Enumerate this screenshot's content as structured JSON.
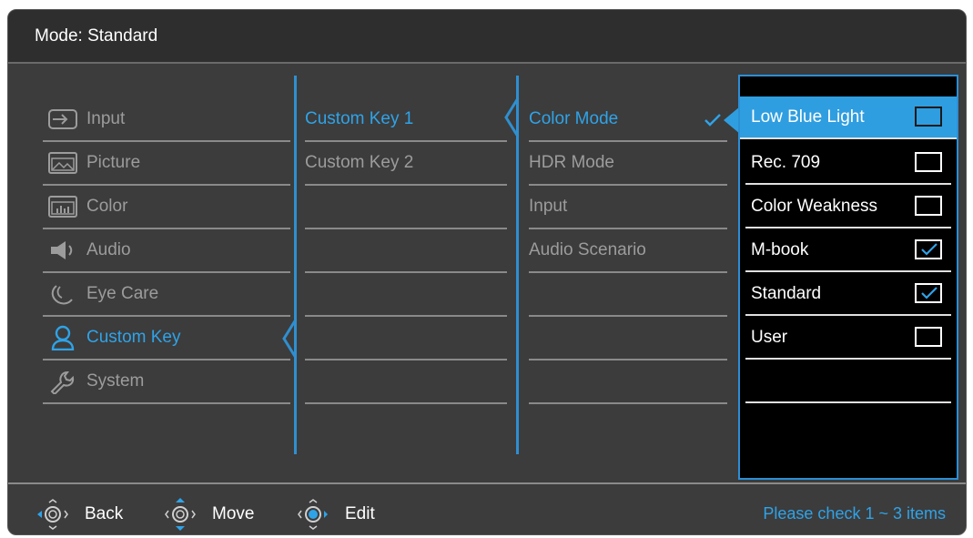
{
  "header": {
    "title": "Mode: Standard"
  },
  "menu": {
    "items": [
      {
        "label": "Input",
        "icon": "input-icon"
      },
      {
        "label": "Picture",
        "icon": "picture-icon"
      },
      {
        "label": "Color",
        "icon": "color-icon"
      },
      {
        "label": "Audio",
        "icon": "speaker-icon"
      },
      {
        "label": "Eye Care",
        "icon": "eye-care-icon"
      },
      {
        "label": "Custom Key",
        "icon": "user-icon"
      },
      {
        "label": "System",
        "icon": "wrench-icon"
      }
    ],
    "selected": "Custom Key"
  },
  "submenu": {
    "items": [
      "Custom Key 1",
      "Custom Key 2"
    ],
    "selected": "Custom Key 1"
  },
  "functions": {
    "items": [
      "Color Mode",
      "HDR Mode",
      "Input",
      "Audio Scenario"
    ],
    "selected": "Color Mode"
  },
  "options": {
    "items": [
      {
        "label": "Low Blue Light",
        "checked": false
      },
      {
        "label": "Rec. 709",
        "checked": false
      },
      {
        "label": "Color Weakness",
        "checked": false
      },
      {
        "label": "M-book",
        "checked": true
      },
      {
        "label": "Standard",
        "checked": true
      },
      {
        "label": "User",
        "checked": false
      }
    ],
    "highlighted": "Low Blue Light"
  },
  "footer": {
    "back_label": "Back",
    "move_label": "Move",
    "edit_label": "Edit",
    "hint": "Please check 1 ~ 3 items"
  },
  "colors": {
    "accent": "#2fa3e8",
    "panel": "#3c3c3c",
    "options_bg": "#000000"
  }
}
